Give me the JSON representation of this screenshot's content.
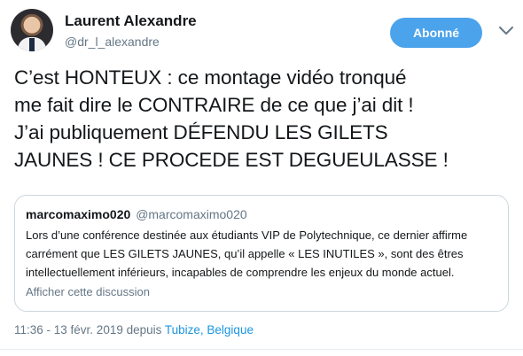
{
  "author": {
    "name": "Laurent Alexandre",
    "handle": "@dr_l_alexandre",
    "avatar": "profile-photo"
  },
  "follow_button": {
    "label": "Abonné",
    "color": "#4ba3eb"
  },
  "menu_icon": "chevron-down-icon",
  "tweet": {
    "lines": [
      "C’est HONTEUX : ce montage vidéo tronqué",
      "me fait dire le CONTRAIRE de ce que j’ai dit !",
      "J’ai publiquement DÉFENDU LES GILETS",
      "JAUNES ! CE PROCEDE EST DEGUEULASSE !"
    ]
  },
  "quoted": {
    "name": "marcomaximo020",
    "handle": "@marcomaximo020",
    "lines": [
      "Lors d’une conférence destinée aux étudiants VIP de Polytechnique, ce dernier affirme",
      "carrément que LES GILETS JAUNES, qu’il appelle « LES INUTILES », sont des êtres",
      "intellectuellement inférieurs, incapables de comprendre les enjeux du monde actuel."
    ],
    "show_thread": "Afficher cette discussion"
  },
  "meta": {
    "datetime": "11:36 - 13 févr. 2019 depuis",
    "location": "Tubize, Belgique",
    "link_color": "#1b95e0"
  }
}
